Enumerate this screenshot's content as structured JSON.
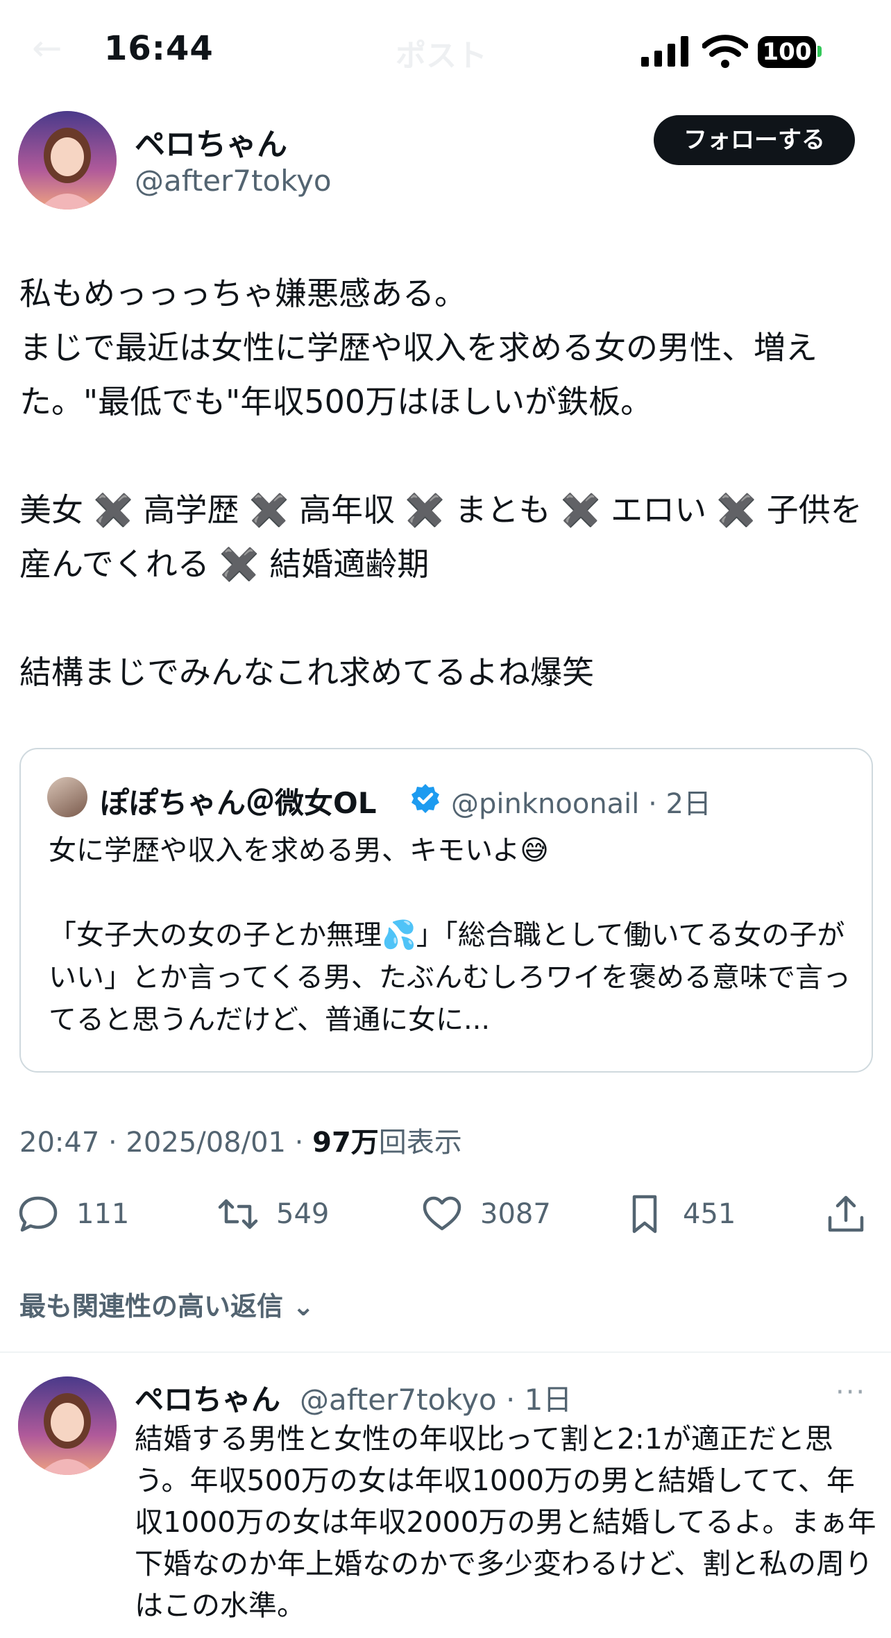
{
  "status_bar": {
    "time": "16:44",
    "battery": "100"
  },
  "header": {
    "title": "ポスト"
  },
  "post": {
    "display_name": "ペロちゃん",
    "handle": "@after7tokyo",
    "follow_label": "フォローする",
    "text": "私もめっっっちゃ嫌悪感ある。\nまじで最近は女性に学歴や収入を求める女の男性、増えた。\"最低でも\"年収500万はほしいが鉄板。\n\n美女 ✖️ 高学歴 ✖️ 高年収 ✖️ まとも ✖️ エロい ✖️ 子供を産んでくれる ✖️ 結婚適齢期\n\n結構まじでみんなこれ求めてるよね爆笑",
    "timestamp": "20:47 · 2025/08/01 · ",
    "views_count": "97万",
    "views_label": "回表示"
  },
  "quote": {
    "display_name": "ぽぽちゃん＠微女OL",
    "handle_time": "@pinknoonail · 2日",
    "text": "女に学歴や収入を求める男、キモいよ😅\n\n「女子大の女の子とか無理💦」「総合職として働いてる女の子がいい」とか言ってくる男、たぶんむしろワイを褒める意味で言ってると思うんだけど、普通に女に..."
  },
  "actions": {
    "replies": "111",
    "reposts": "549",
    "likes": "3087",
    "bookmarks": "451"
  },
  "replies_sort": "最も関連性の高い返信",
  "reply": {
    "display_name": "ペロちゃん",
    "handle_time": "@after7tokyo · 1日",
    "more": "···",
    "text": "結婚する男性と女性の年収比って割と2:1が適正だと思う。年収500万の女は年収1000万の男と結婚してて、年収1000万の女は年収2000万の男と結婚してるよ。まぁ年下婚なのか年上婚なのかで多少変わるけど、割と私の周りはこの水準。"
  }
}
